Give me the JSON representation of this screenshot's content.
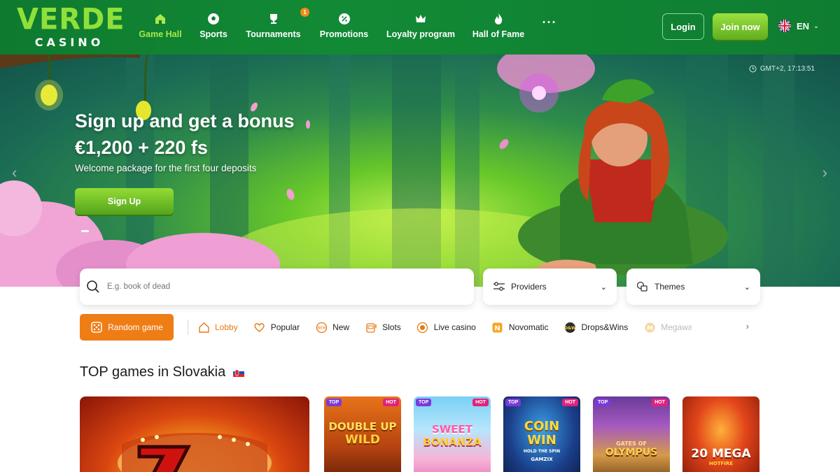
{
  "header": {
    "logo_top": "VERDE",
    "logo_bottom": "CASINO",
    "nav": [
      {
        "label": "Game Hall",
        "icon": "home-icon",
        "active": true
      },
      {
        "label": "Sports",
        "icon": "soccer-ball-icon"
      },
      {
        "label": "Tournaments",
        "icon": "trophy-icon",
        "badge": "1"
      },
      {
        "label": "Promotions",
        "icon": "percent-badge-icon"
      },
      {
        "label": "Loyalty program",
        "icon": "crown-icon"
      },
      {
        "label": "Hall of Fame",
        "icon": "flame-icon"
      }
    ],
    "more": "···",
    "login_label": "Login",
    "join_label": "Join now",
    "language": "EN"
  },
  "hero": {
    "time": "GMT+2, 17:13:51",
    "title": "Sign up and get a bonus",
    "amount": "€1,200 + 220 fs",
    "subtitle": "Welcome package for the first four deposits",
    "cta": "Sign Up"
  },
  "search": {
    "placeholder": "E.g. book of dead",
    "providers_label": "Providers",
    "themes_label": "Themes"
  },
  "categories": {
    "random_label": "Random game",
    "items": [
      {
        "label": "Lobby",
        "icon": "home-icon",
        "active": true
      },
      {
        "label": "Popular",
        "icon": "heart-icon"
      },
      {
        "label": "New",
        "icon": "new-badge-icon"
      },
      {
        "label": "Slots",
        "icon": "slot-machine-icon"
      },
      {
        "label": "Live casino",
        "icon": "live-dot-icon"
      },
      {
        "label": "Novomatic",
        "icon": "novomatic-logo-icon"
      },
      {
        "label": "Drops&Wins",
        "icon": "drops-wins-logo-icon"
      },
      {
        "label": "Megaways",
        "icon": "megaways-logo-icon"
      }
    ]
  },
  "top_games": {
    "title": "TOP games in Slovakia",
    "tags": {
      "top": "TOP",
      "hot": "HOT"
    },
    "games": [
      {
        "name": "DOUBLE UP WILD",
        "line1": "DOUBLE UP",
        "line2": "WILD"
      },
      {
        "name": "SWEET BONANZA",
        "line1": "SWEET",
        "line2": "BONANZA"
      },
      {
        "name": "COIN WIN",
        "line1": "COIN",
        "line2": "WIN",
        "sub": "HOLD THE SPIN",
        "provider": "GAMZIX"
      },
      {
        "name": "GATES OF OLYMPUS",
        "line1": "GATES OF",
        "line2": "OLYMPUS"
      },
      {
        "name": "20 MEGA HOTFIRE",
        "line1": "20 MEGA",
        "line2": "HOTFIRE"
      }
    ]
  },
  "colors": {
    "header_green": "#0e7a2f",
    "accent_lime": "#8fe03a",
    "accent_orange": "#ef7d16",
    "tag_top": "#7a3ad9",
    "tag_hot": "#e2227a"
  }
}
